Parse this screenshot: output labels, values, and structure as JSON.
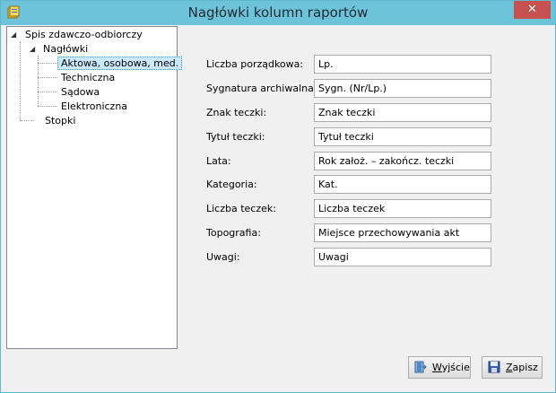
{
  "window": {
    "title": "Nagłówki kolumn raportów",
    "close_label": "✕"
  },
  "tree": {
    "root": "Spis zdawczo-odbiorczy",
    "headers": "Nagłówki",
    "headers_children": [
      "Aktowa, osobowa, med.",
      "Techniczna",
      "Sądowa",
      "Elektroniczna"
    ],
    "footers": "Stopki"
  },
  "form": {
    "fields": [
      {
        "label": "Liczba porządkowa:",
        "value": "Lp."
      },
      {
        "label": "Sygnatura archiwalna:",
        "value": "Sygn. (Nr/Lp.)"
      },
      {
        "label": "Znak teczki:",
        "value": "Znak teczki"
      },
      {
        "label": "Tytuł teczki:",
        "value": "Tytuł teczki"
      },
      {
        "label": "Lata:",
        "value": "Rok założ. – zakończ. teczki"
      },
      {
        "label": "Kategoria:",
        "value": "Kat."
      },
      {
        "label": "Liczba teczek:",
        "value": "Liczba teczek"
      },
      {
        "label": "Topografia:",
        "value": "Miejsce przechowywania akt"
      },
      {
        "label": "Uwagi:",
        "value": "Uwagi"
      }
    ]
  },
  "buttons": {
    "exit": {
      "underlined": "W",
      "rest": "yjście"
    },
    "save": {
      "underlined": "Z",
      "rest": "apisz"
    }
  },
  "colors": {
    "titlebar": "#6dc4da",
    "close": "#c75050",
    "selection": "#cce8ff"
  }
}
